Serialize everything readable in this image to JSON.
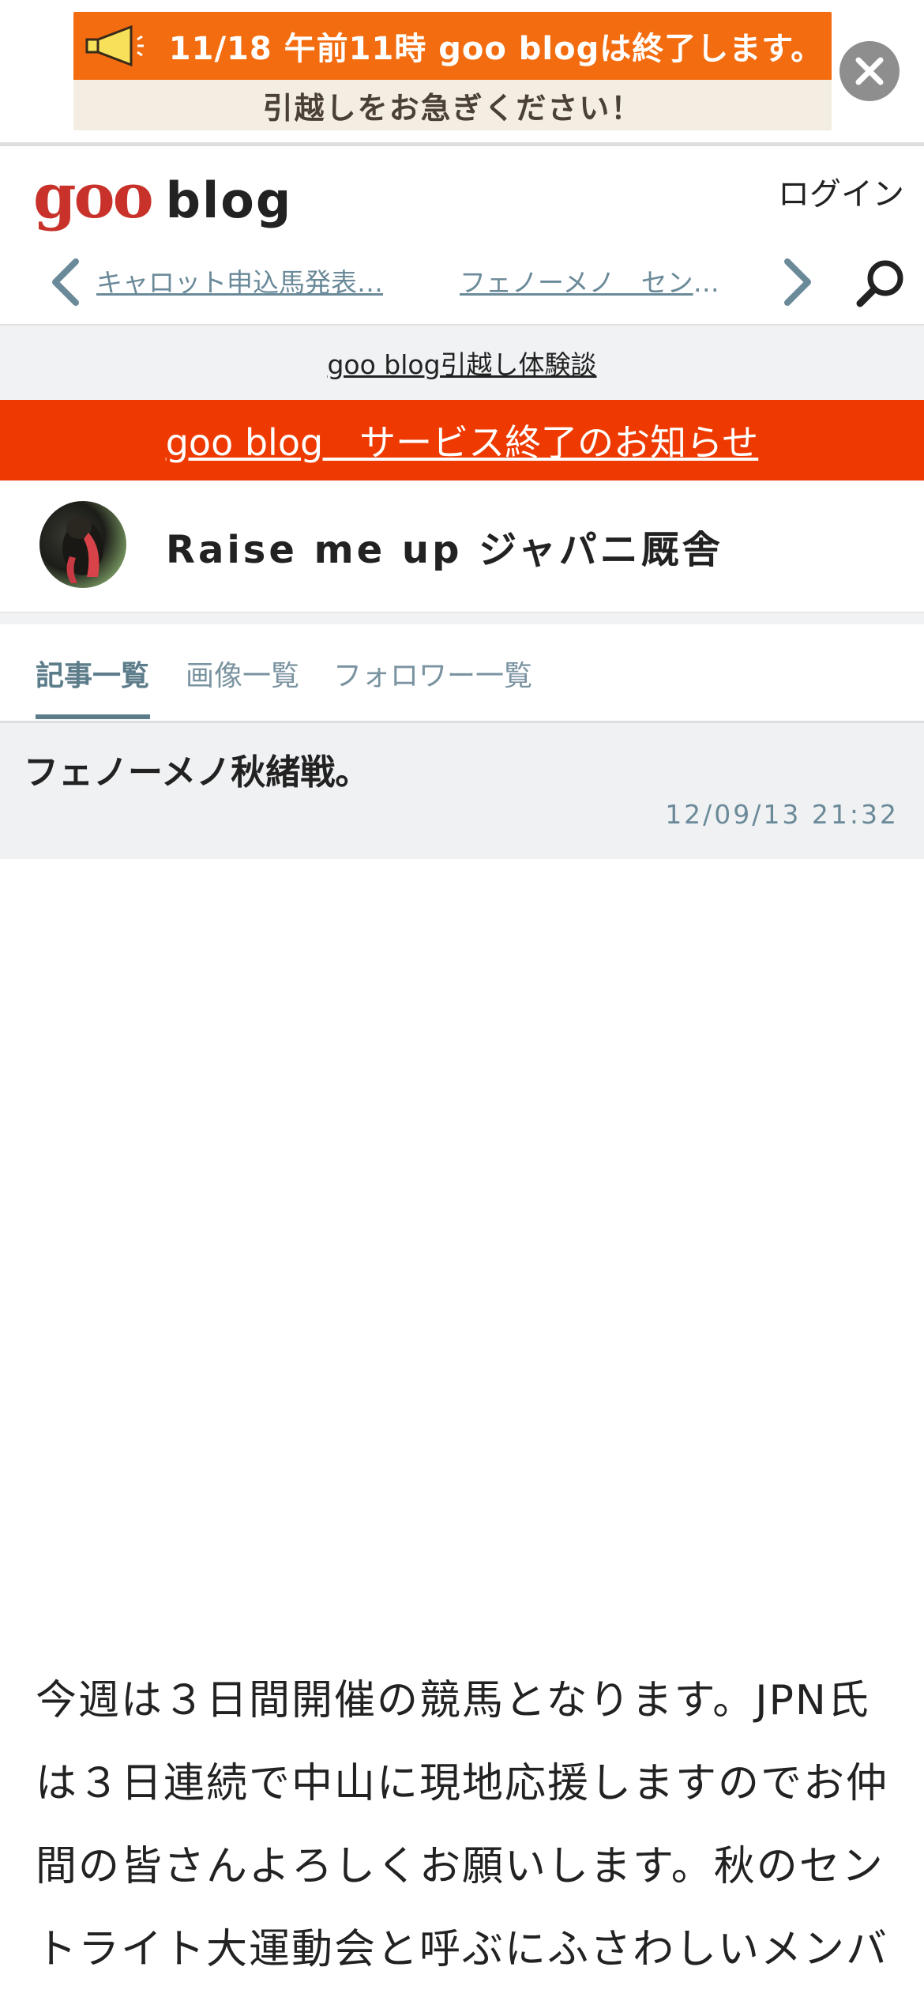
{
  "promo": {
    "headline": "11/18 午前11時 goo blogは終了します。",
    "subline": "引越しをお急ぎください！",
    "icons": {
      "megaphone": "megaphone-icon",
      "close": "close-icon"
    },
    "colors": {
      "banner_top": "#f36c0f",
      "banner_bottom": "#f4eee2",
      "close_button": "#8e8e8e"
    }
  },
  "header": {
    "logo_goo": "goo",
    "logo_blog": "blog",
    "login_label": "ログイン",
    "prev_article": "キャロット申込馬発表…",
    "next_article": "フェノーメノ　セント…",
    "icons": {
      "prev": "chevron-left-icon",
      "next": "chevron-right-icon",
      "search": "search-icon"
    }
  },
  "story_bar": {
    "label": "goo blog引越し体験談"
  },
  "notice": {
    "label": "goo blog　サービス終了のお知らせ",
    "color": "#ee3a00"
  },
  "blog": {
    "title": "Raise me up ジャパニ厩舎"
  },
  "tabs": [
    {
      "label": "記事一覧",
      "active": true
    },
    {
      "label": "画像一覧",
      "active": false
    },
    {
      "label": "フォロワー一覧",
      "active": false
    }
  ],
  "article": {
    "title": "フェノーメノ秋緒戦。",
    "date": "12/09/13 21:32",
    "body": "今週は３日間開催の競馬となります。JPN氏は３日連続で中山に現地応援しますのでお仲間の皆さんよろしくお願いします。秋のセントライト大運動会と呼ぶにふさわしいメンバ"
  }
}
